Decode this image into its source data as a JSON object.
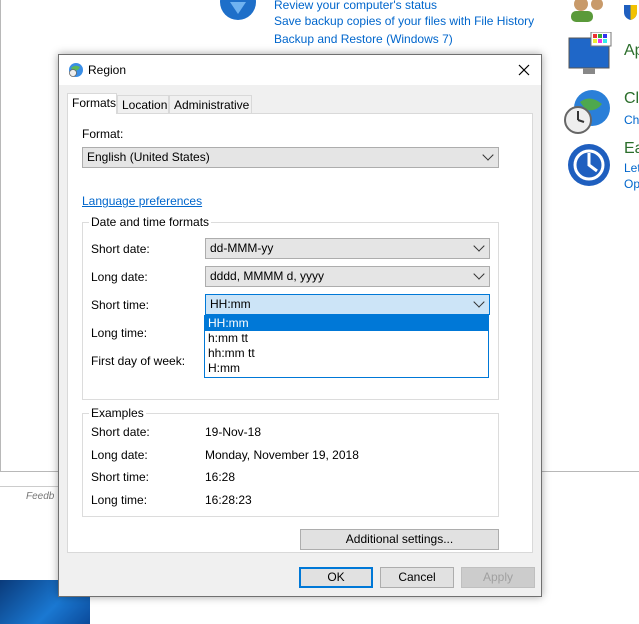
{
  "background": {
    "links": [
      "Review your computer's status",
      "Save backup copies of your files with File History",
      "Backup and Restore (Windows 7)"
    ],
    "right_items": [
      {
        "title": "Ap",
        "sub": ""
      },
      {
        "title": "Cl",
        "sub": "Ch"
      },
      {
        "title": "Ea",
        "sub": "Let"
      },
      {
        "title": "",
        "sub": "Op"
      }
    ],
    "feedback": "Feedb"
  },
  "dialog": {
    "title": "Region",
    "tabs": [
      "Formats",
      "Location",
      "Administrative"
    ],
    "format_label": "Format:",
    "format_value": "English (United States)",
    "language_link": "Language preferences",
    "dt_group_title": "Date and time formats",
    "rows": {
      "short_date_label": "Short date:",
      "short_date_value": "dd-MMM-yy",
      "long_date_label": "Long date:",
      "long_date_value": "dddd, MMMM d, yyyy",
      "short_time_label": "Short time:",
      "short_time_value": "HH:mm",
      "long_time_label": "Long time:",
      "first_day_label": "First day of week:"
    },
    "dropdown_options": [
      "HH:mm",
      "h:mm tt",
      "hh:mm tt",
      "H:mm"
    ],
    "examples": {
      "title": "Examples",
      "short_date_label": "Short date:",
      "short_date_value": "19-Nov-18",
      "long_date_label": "Long date:",
      "long_date_value": "Monday, November 19, 2018",
      "short_time_label": "Short time:",
      "short_time_value": "16:28",
      "long_time_label": "Long time:",
      "long_time_value": "16:28:23"
    },
    "additional_settings": "Additional settings...",
    "ok": "OK",
    "cancel": "Cancel",
    "apply": "Apply"
  }
}
